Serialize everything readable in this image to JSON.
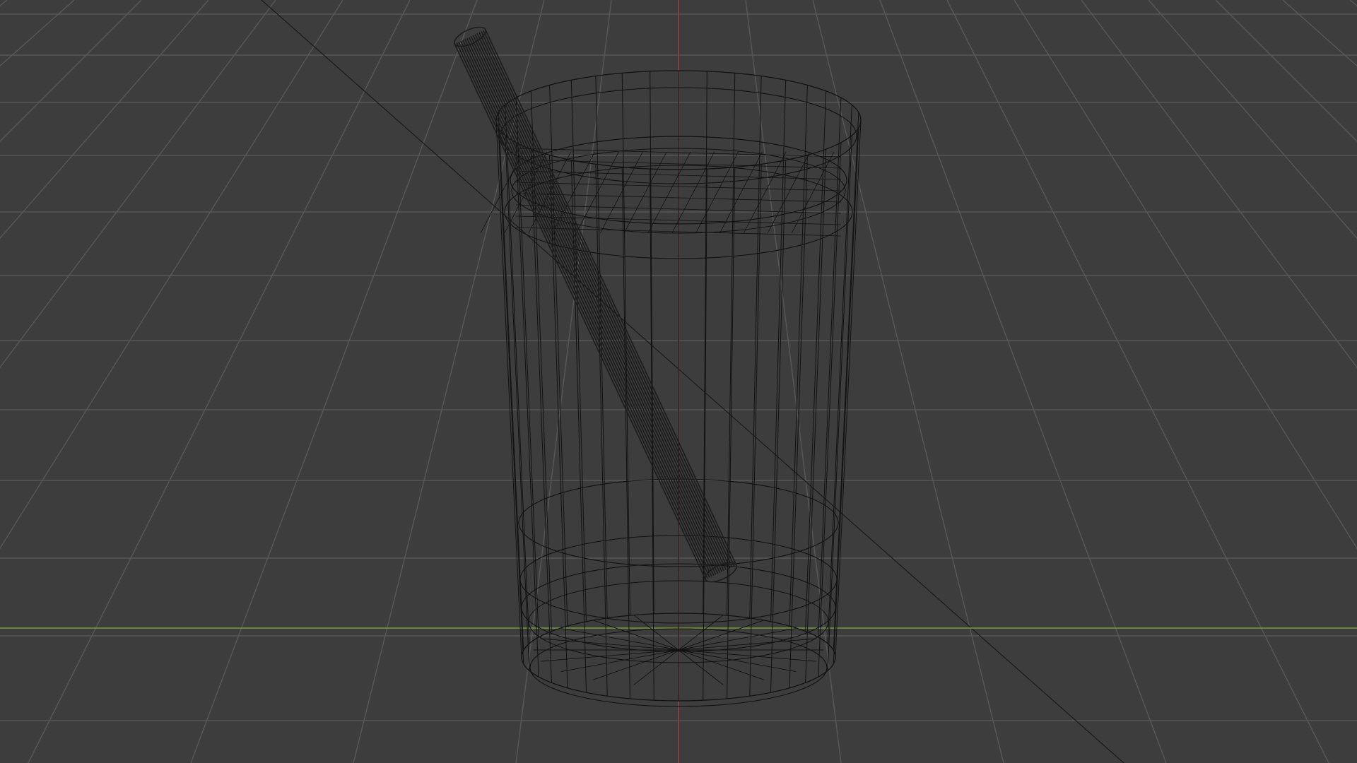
{
  "viewport": {
    "shading_mode": "wireframe",
    "background_color": "#3d3d3d",
    "grid_color": "#575757",
    "x_axis_color": "#7d9a3a",
    "y_axis_color": "#9a3a4a",
    "wire_color": "#111111"
  },
  "scene": {
    "objects": [
      {
        "name": "glass",
        "type": "mesh"
      },
      {
        "name": "liquid",
        "type": "mesh"
      },
      {
        "name": "straw",
        "type": "mesh"
      }
    ]
  }
}
